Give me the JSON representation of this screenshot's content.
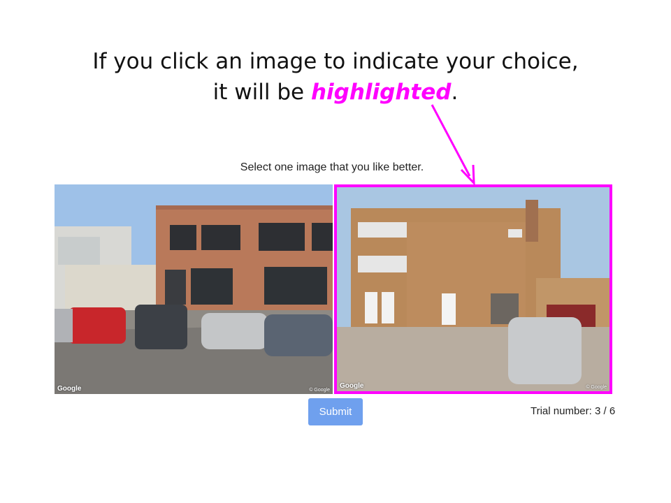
{
  "heading": {
    "line1": "If you click an image to indicate your choice,",
    "line2_prefix": "it will be ",
    "line2_emphasis": "highlighted",
    "line2_suffix": "."
  },
  "instruction": "Select one image that you like better.",
  "images": [
    {
      "label": "street view image A",
      "watermark": "Google",
      "copyright": "© Google",
      "selected": false
    },
    {
      "label": "street view image B",
      "watermark": "Google",
      "copyright": "© Google",
      "selected": true
    }
  ],
  "submit_label": "Submit",
  "trial": {
    "text": "Trial number: 3 / 6"
  },
  "colors": {
    "highlight": "#ff00ff",
    "submit_bg": "#6fa0ee",
    "arrow": "#ff00ff"
  }
}
